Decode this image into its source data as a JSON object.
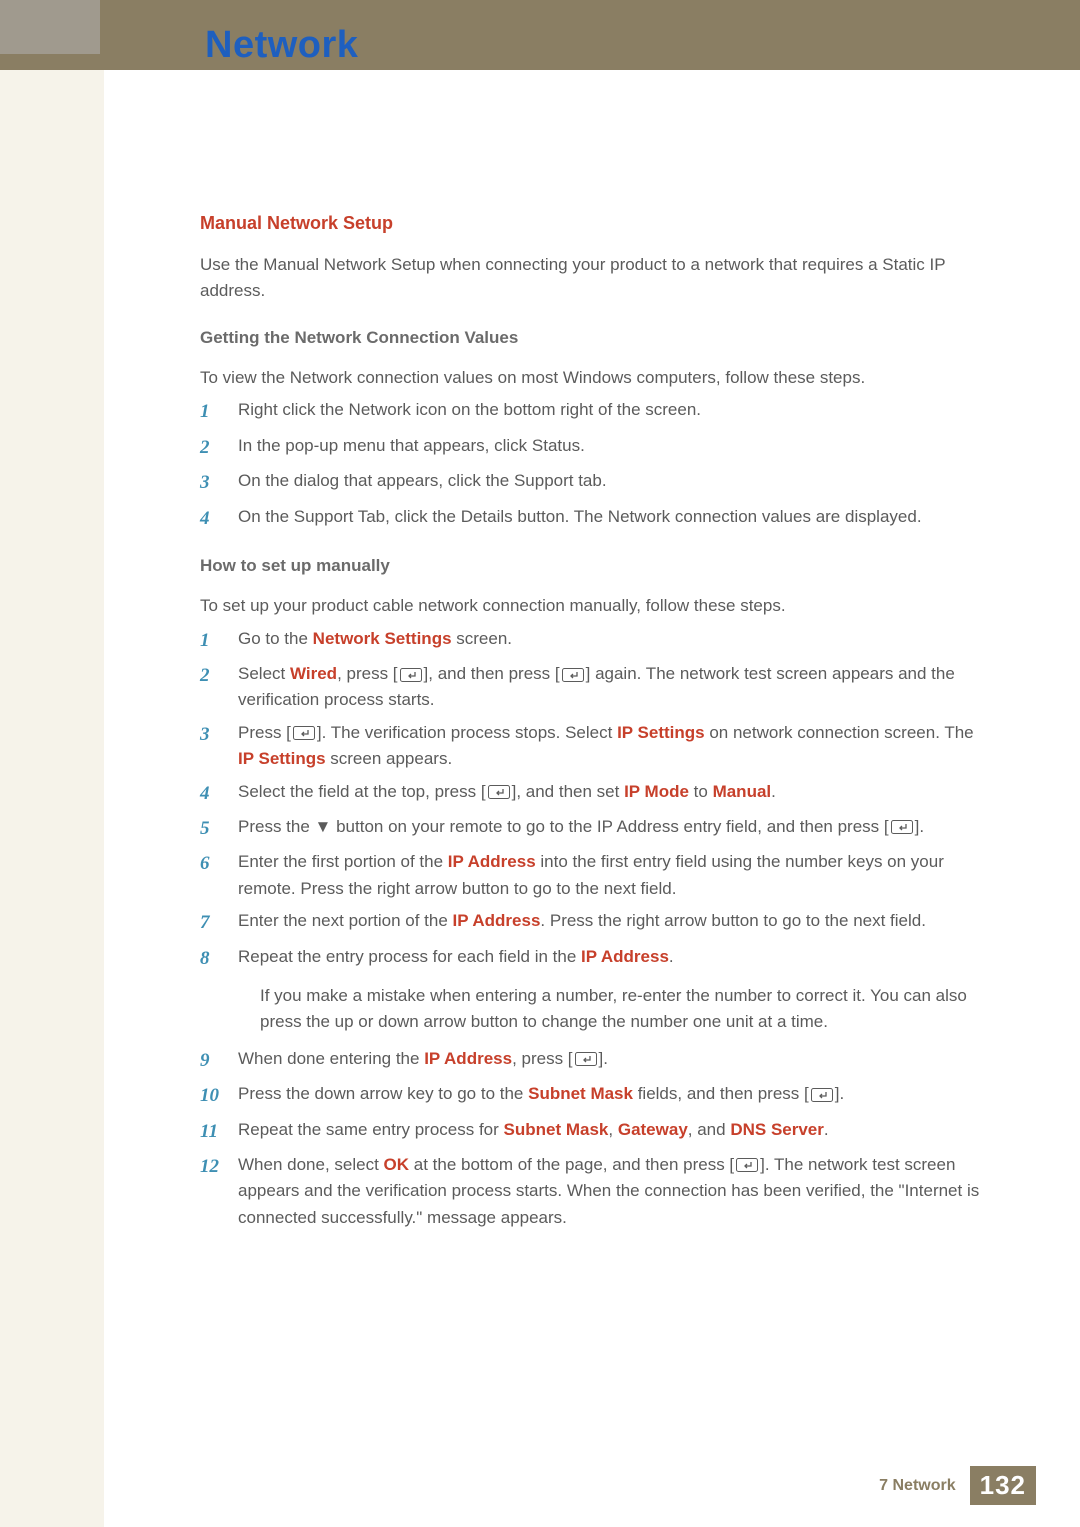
{
  "chapter_title": "Network",
  "section_title": "Manual Network Setup",
  "intro_para": "Use the Manual Network Setup when connecting your product to a network that requires a Static IP address.",
  "sub1_title": "Getting the Network Connection Values",
  "sub1_para": "To view the Network connection values on most Windows computers, follow these steps.",
  "sub1_steps": [
    "Right click the Network icon on the bottom right of the screen.",
    "In the pop-up menu that appears, click Status.",
    "On the dialog that appears, click the Support tab.",
    "On the Support Tab, click the Details button. The Network connection values are displayed."
  ],
  "sub2_title": "How to set up manually",
  "sub2_para": "To set up your product cable network connection manually, follow these steps.",
  "step2_1_a": "Go to the ",
  "step2_1_kw": "Network Settings",
  "step2_1_b": " screen.",
  "step2_2_a": "Select ",
  "step2_2_kw1": "Wired",
  "step2_2_b": ", press [",
  "step2_2_c": "], and then press [",
  "step2_2_d": "] again. The network test screen appears and the verification process starts.",
  "step2_3_a": "Press [",
  "step2_3_b": "]. The verification process stops. Select ",
  "step2_3_kw1": "IP Settings",
  "step2_3_c": " on network connection screen. The ",
  "step2_3_kw2": "IP Settings",
  "step2_3_d": " screen appears.",
  "step2_4_a": "Select the field at the top, press [",
  "step2_4_b": "], and then set ",
  "step2_4_kw1": "IP Mode",
  "step2_4_c": " to ",
  "step2_4_kw2": "Manual",
  "step2_4_d": ".",
  "step2_5_a": "Press the ▼ button on your remote to go to the IP Address entry field, and then press [",
  "step2_5_b": "].",
  "step2_6_a": "Enter the first portion of the ",
  "step2_6_kw": "IP Address",
  "step2_6_b": " into the first entry field using the number keys on your remote. Press the right arrow button to go to the next field.",
  "step2_7_a": "Enter the next portion of the ",
  "step2_7_kw": "IP Address",
  "step2_7_b": ". Press the right arrow button to go to the next field.",
  "step2_8_a": "Repeat the entry process for each field in the ",
  "step2_8_kw": "IP Address",
  "step2_8_b": ".",
  "note_text": "If you make a mistake when entering a number, re-enter the number to correct it. You can also press the up or down arrow button to change the number one unit at a time.",
  "step2_9_a": "When done entering the ",
  "step2_9_kw": "IP Address",
  "step2_9_b": ", press [",
  "step2_9_c": "].",
  "step2_10_a": "Press the down arrow key to go to the ",
  "step2_10_kw": "Subnet Mask",
  "step2_10_b": " fields, and then press [",
  "step2_10_c": "].",
  "step2_11_a": "Repeat the same entry process for ",
  "step2_11_kw1": "Subnet Mask",
  "step2_11_b": ", ",
  "step2_11_kw2": "Gateway",
  "step2_11_c": ", and ",
  "step2_11_kw3": "DNS Server",
  "step2_11_d": ".",
  "step2_12_a": "When done, select ",
  "step2_12_kw": "OK",
  "step2_12_b": " at the bottom of the page, and then press [",
  "step2_12_c": "]. The network test screen appears and the verification process starts. When the connection has been verified, the \"Internet is connected successfully.\" message appears.",
  "numbers": {
    "n1": "1",
    "n2": "2",
    "n3": "3",
    "n4": "4",
    "n5": "5",
    "n6": "6",
    "n7": "7",
    "n8": "8",
    "n9": "9",
    "n10": "10",
    "n11": "11",
    "n12": "12"
  },
  "footer": {
    "label": "7 Network",
    "page": "132"
  }
}
